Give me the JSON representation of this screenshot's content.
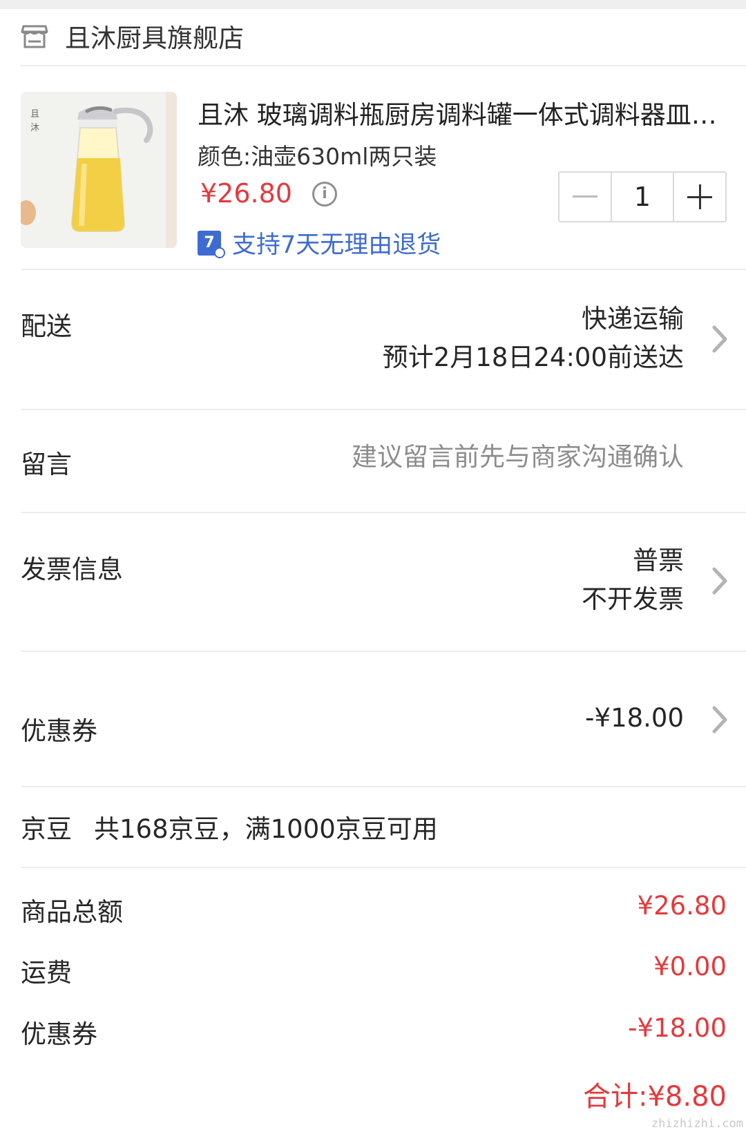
{
  "store": {
    "name": "且沐厨具旗舰店",
    "icon": "store-icon"
  },
  "product": {
    "title": "且沐 玻璃调料瓶厨房调料罐一体式调料器皿油壶套装",
    "spec": "颜色:油壶630ml两只装",
    "price": "¥26.80",
    "quantity": "1",
    "return_policy": "支持7天无理由退货",
    "return_badge": "7"
  },
  "delivery": {
    "label": "配送",
    "method": "快递运输",
    "eta": "预计2月18日24:00前送达"
  },
  "message": {
    "label": "留言",
    "placeholder": "建议留言前先与商家沟通确认"
  },
  "invoice": {
    "label": "发票信息",
    "type": "普票",
    "status": "不开发票"
  },
  "coupon": {
    "label": "优惠券",
    "value": "-¥18.00"
  },
  "jingdou": {
    "label": "京豆",
    "text": "共168京豆，满1000京豆可用"
  },
  "summary": [
    {
      "label": "商品总额",
      "value": "¥26.80"
    },
    {
      "label": "运费",
      "value": "¥0.00"
    },
    {
      "label": "优惠券",
      "value": "-¥18.00"
    }
  ],
  "total": {
    "label": "合计:",
    "value": "¥8.80"
  },
  "watermark": "zhizhizhi.com",
  "colors": {
    "price_red": "#e4393c",
    "link_blue": "#3e6bd1",
    "muted_gray": "#8c8c8c"
  }
}
